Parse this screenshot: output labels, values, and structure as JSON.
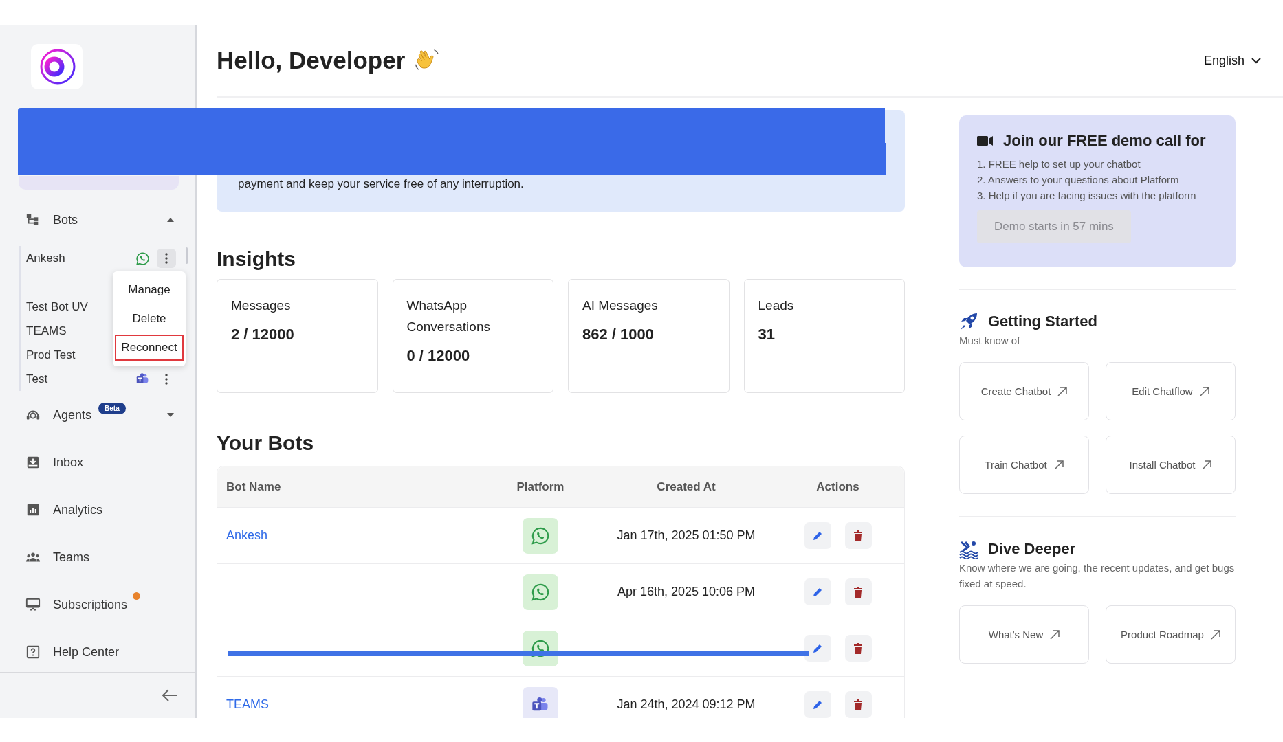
{
  "sidebar": {
    "home": {
      "selected": true
    },
    "items": [
      {
        "label": "Bots",
        "expanded": true,
        "bots": [
          {
            "name": "Ankesh",
            "kind": "whatsapp",
            "menu_open": true
          },
          {
            "kind": "hidden"
          },
          {
            "name": "Test Bot UV",
            "kind": "hidden"
          },
          {
            "name": "TEAMS",
            "kind": "hidden"
          },
          {
            "name": "Prod Test",
            "kind": "hidden"
          },
          {
            "name": "Test",
            "kind": "teams"
          }
        ]
      },
      {
        "label": "Agents",
        "badge": "Beta",
        "expanded": false
      },
      {
        "label": "Inbox"
      },
      {
        "label": "Analytics"
      },
      {
        "label": "Teams"
      },
      {
        "label": "Subscriptions",
        "notification": true
      },
      {
        "label": "Help Center"
      }
    ],
    "context_menu": [
      {
        "label": "Manage",
        "selected": false
      },
      {
        "label": "Delete",
        "selected": false
      },
      {
        "label": "Reconnect",
        "selected": true
      }
    ]
  },
  "header": {
    "title": "Hello, Developer",
    "language": "English"
  },
  "banner": {
    "text": "payment and keep your service free of any interruption."
  },
  "insights": {
    "title": "Insights",
    "cards": [
      {
        "label": "Messages",
        "value": "2 / 12000"
      },
      {
        "label": "WhatsApp Conversations",
        "value": "0 / 12000"
      },
      {
        "label": "AI Messages",
        "value": "862 / 1000"
      },
      {
        "label": "Leads",
        "value": "31"
      }
    ]
  },
  "bots_table": {
    "title": "Your Bots",
    "columns": [
      "Bot Name",
      "Platform",
      "Created At",
      "Actions"
    ],
    "rows": [
      {
        "name": "Ankesh",
        "kind": "whatsapp",
        "created": "Jan 17th, 2025 01:50 PM"
      },
      {
        "kind": "whatsapp",
        "created": "Apr 16th, 2025 10:06 PM"
      },
      {
        "kind": "whatsapp"
      },
      {
        "name": "TEAMS",
        "kind": "teams",
        "created": "Jan 24th, 2024 09:12 PM"
      }
    ]
  },
  "demo": {
    "title": "Join our FREE demo call for",
    "points": [
      "1. FREE help to set up your chatbot",
      "2. Answers to your questions about Platform",
      "3. Help if you are facing issues with the platform"
    ],
    "button": {
      "label": "Demo starts in 57 mins",
      "disabled": true
    }
  },
  "getting_started": {
    "title": "Getting Started",
    "subtitle": "Must know of",
    "links": [
      "Create Chatbot",
      "Edit Chatflow",
      "Train Chatbot",
      "Install Chatbot"
    ]
  },
  "dive_deeper": {
    "title": "Dive Deeper",
    "subtitle": "Know where we are going, the recent updates, and get bugs fixed at speed.",
    "links": [
      "What's New",
      "Product Roadmap"
    ]
  }
}
